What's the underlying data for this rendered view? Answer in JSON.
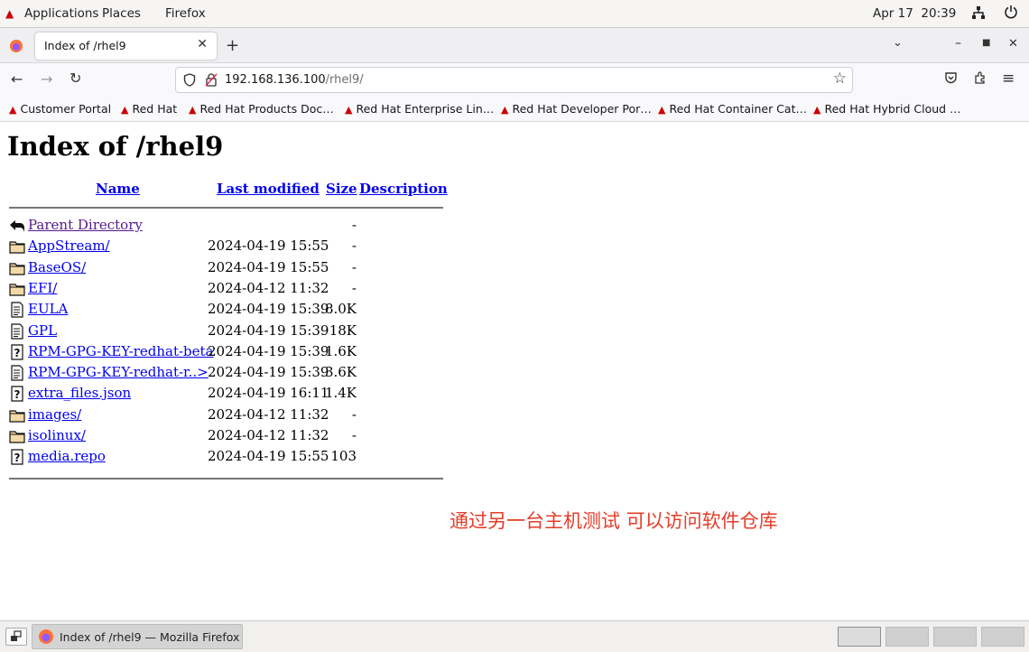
{
  "topbar": {
    "applications": "Applications",
    "places": "Places",
    "firefox": "Firefox",
    "datetime": "Apr 17  20:39"
  },
  "tab": {
    "title": "Index of /rhel9"
  },
  "urlbar": {
    "host": "192.168.136.100",
    "path": "/rhel9/"
  },
  "bookmarks": [
    "Customer Portal",
    "Red Hat",
    "Red Hat Products Doc…",
    "Red Hat Enterprise Lin…",
    "Red Hat Developer Por…",
    "Red Hat Container Cat…",
    "Red Hat Hybrid Cloud …"
  ],
  "page": {
    "heading": "Index of /rhel9",
    "columns": {
      "name": "Name",
      "modified": "Last modified",
      "size": "Size",
      "description": "Description"
    },
    "rows": [
      {
        "icon": "back-icon",
        "name": "Parent Directory",
        "modified": "",
        "size": "-"
      },
      {
        "icon": "folder-icon",
        "name": "AppStream/",
        "modified": "2024-04-19 15:55",
        "size": "-"
      },
      {
        "icon": "folder-icon",
        "name": "BaseOS/",
        "modified": "2024-04-19 15:55",
        "size": "-"
      },
      {
        "icon": "folder-icon",
        "name": "EFI/",
        "modified": "2024-04-12 11:32",
        "size": "-"
      },
      {
        "icon": "text-file-icon",
        "name": "EULA",
        "modified": "2024-04-19 15:39",
        "size": "8.0K"
      },
      {
        "icon": "text-file-icon",
        "name": "GPL",
        "modified": "2024-04-19 15:39",
        "size": "18K"
      },
      {
        "icon": "unknown-file-icon",
        "name": "RPM-GPG-KEY-redhat-beta",
        "modified": "2024-04-19 15:39",
        "size": "1.6K"
      },
      {
        "icon": "text-file-icon",
        "name": "RPM-GPG-KEY-redhat-r..>",
        "modified": "2024-04-19 15:39",
        "size": "3.6K"
      },
      {
        "icon": "unknown-file-icon",
        "name": "extra_files.json",
        "modified": "2024-04-19 16:11",
        "size": "1.4K"
      },
      {
        "icon": "folder-icon",
        "name": "images/",
        "modified": "2024-04-12 11:32",
        "size": "-"
      },
      {
        "icon": "folder-icon",
        "name": "isolinux/",
        "modified": "2024-04-12 11:32",
        "size": "-"
      },
      {
        "icon": "unknown-file-icon",
        "name": "media.repo",
        "modified": "2024-04-19 15:55",
        "size": "103"
      }
    ],
    "annotation": "通过另一台主机测试  可以访问软件仓库"
  },
  "taskbar": {
    "window_title": "Index of /rhel9 — Mozilla Firefox"
  },
  "colors": {
    "link": "#0000ee",
    "visited_link": "#551a8b",
    "annotation": "#e53d2a",
    "redhat": "#cc0000"
  }
}
